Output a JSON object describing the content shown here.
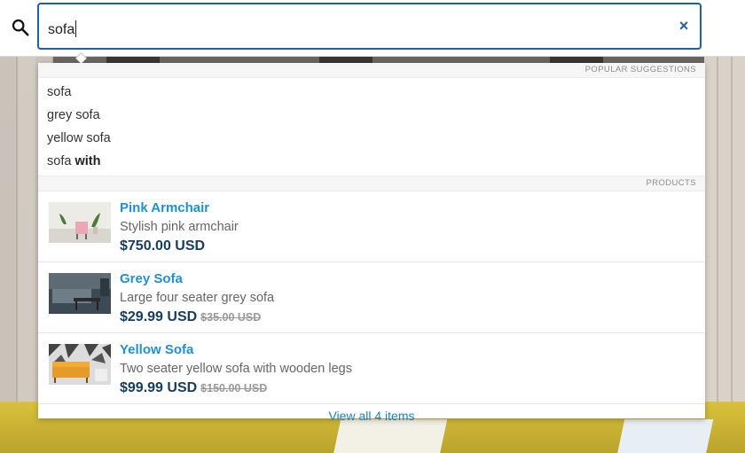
{
  "search": {
    "value": "sofa",
    "clear_label": "×"
  },
  "suggestions": {
    "header": "POPULAR SUGGESTIONS",
    "items": [
      {
        "plain": "sofa",
        "bold": ""
      },
      {
        "plain": "grey sofa",
        "bold": ""
      },
      {
        "plain": "yellow sofa",
        "bold": ""
      },
      {
        "plain": "sofa ",
        "bold": "with"
      }
    ]
  },
  "products": {
    "header": "PRODUCTS",
    "items": [
      {
        "name": "Pink Armchair",
        "description": "Stylish pink armchair",
        "price": "$750.00 USD",
        "old_price": ""
      },
      {
        "name": "Grey Sofa",
        "description": "Large four seater grey sofa",
        "price": "$29.99 USD",
        "old_price": "$35.00 USD"
      },
      {
        "name": "Yellow Sofa",
        "description": "Two seater yellow sofa with wooden legs",
        "price": "$99.99 USD",
        "old_price": "$150.00 USD"
      }
    ],
    "view_all": "View all 4 items"
  },
  "colors": {
    "accent": "#1e5fa8",
    "link": "#1e90d6",
    "price": "#173d63"
  },
  "icons": {
    "search": "search-icon",
    "clear": "close-icon"
  }
}
